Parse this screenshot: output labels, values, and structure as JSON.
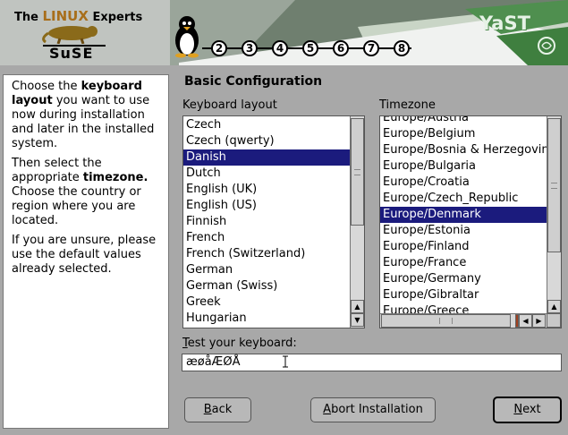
{
  "header": {
    "brand_prefix": "The",
    "brand_accent": "LINUX",
    "brand_suffix": "Experts",
    "logo_text": "SuSE",
    "yast_text": "YaST",
    "steps": [
      "2",
      "3",
      "4",
      "5",
      "6",
      "7",
      "8"
    ]
  },
  "help": {
    "p1_a": "Choose the ",
    "p1_b": "keyboard layout",
    "p1_c": " you want to use now during installation and later in the installed system.",
    "p2_a": "Then select the appropriate ",
    "p2_b": "timezone.",
    "p2_c": " Choose the country or region where you are located.",
    "p3": "If you are unsure, please use the default values already selected."
  },
  "main": {
    "title": "Basic Configuration",
    "keyboard_label": "Keyboard layout",
    "timezone_label": "Timezone",
    "keyboard_items": [
      "Czech",
      "Czech (qwerty)",
      "Danish",
      "Dutch",
      "English (UK)",
      "English (US)",
      "Finnish",
      "French",
      "French (Switzerland)",
      "German",
      "German (Swiss)",
      "Greek",
      "Hungarian"
    ],
    "keyboard_selected": "Danish",
    "timezone_items": [
      "Europe/Austria",
      "Europe/Belgium",
      "Europe/Bosnia & Herzegovina",
      "Europe/Bulgaria",
      "Europe/Croatia",
      "Europe/Czech_Republic",
      "Europe/Denmark",
      "Europe/Estonia",
      "Europe/Finland",
      "Europe/France",
      "Europe/Germany",
      "Europe/Gibraltar",
      "Europe/Greece"
    ],
    "timezone_selected": "Europe/Denmark",
    "test_label_first": "T",
    "test_label_rest": "est your keyboard:",
    "test_value": "æøåÆØÅ"
  },
  "buttons": {
    "back_first": "B",
    "back_rest": "ack",
    "abort_first": "A",
    "abort_rest": "bort Installation",
    "next_first": "N",
    "next_rest": "ext"
  },
  "colors": {
    "selection": "#1b1b7d",
    "background": "#a8a8a8",
    "accent_linux": "#a86e1a"
  }
}
